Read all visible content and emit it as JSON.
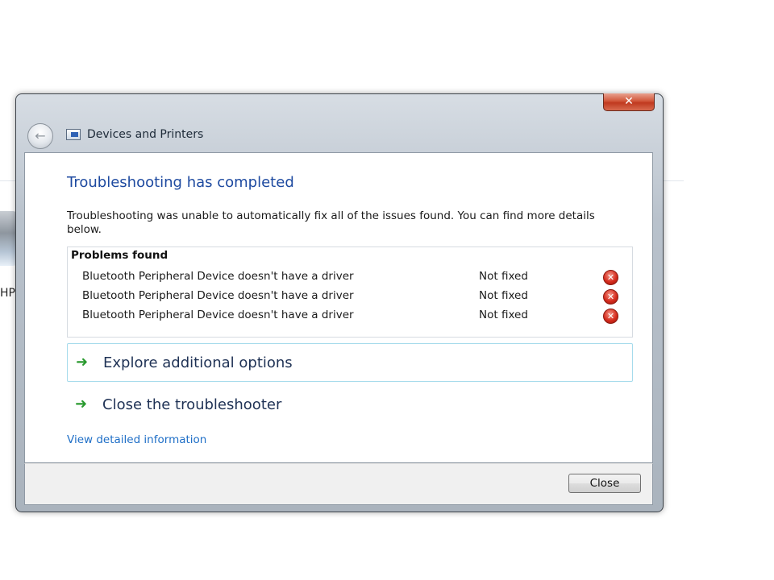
{
  "background": {
    "label": "HP"
  },
  "window": {
    "close_glyph": "✕",
    "back_glyph": "←",
    "title": "Devices and Printers"
  },
  "content": {
    "heading": "Troubleshooting has completed",
    "description": "Troubleshooting was unable to automatically fix all of the issues found. You can find more details below.",
    "problems_title": "Problems found",
    "problems": [
      {
        "description": "Bluetooth Peripheral Device doesn't have a driver",
        "status": "Not fixed",
        "icon": "error-icon"
      },
      {
        "description": "Bluetooth Peripheral Device doesn't have a driver",
        "status": "Not fixed",
        "icon": "error-icon"
      },
      {
        "description": "Bluetooth Peripheral Device doesn't have a driver",
        "status": "Not fixed",
        "icon": "error-icon"
      }
    ],
    "options": [
      {
        "label": "Explore additional options",
        "icon": "green-arrow-icon"
      },
      {
        "label": "Close the troubleshooter",
        "icon": "green-arrow-icon"
      }
    ],
    "details_link": "View detailed information"
  },
  "footer": {
    "close_label": "Close"
  },
  "colors": {
    "heading": "#1e4aa0",
    "link": "#1f6fc7",
    "arrow": "#2a9a2f",
    "error": "#d62c1e",
    "highlight_border": "#a6dbec"
  }
}
